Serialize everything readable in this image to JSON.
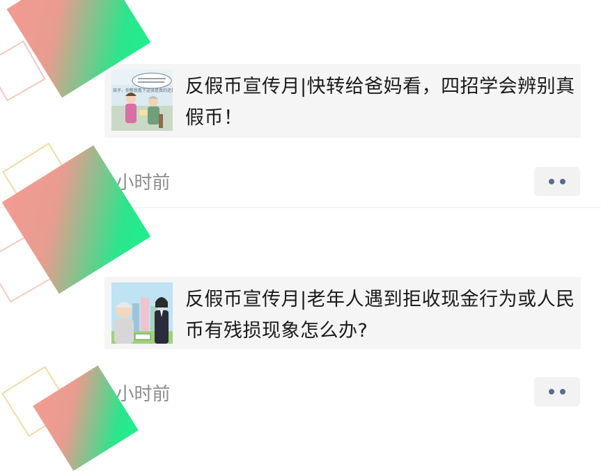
{
  "posts": [
    {
      "card_title": "反假币宣传月|快转给爸妈看，四招学会辨别真假币！",
      "thumbnail_bubble": "孩子，你帮我看下这张是真的还是假的？",
      "timestamp": "1小时前",
      "more_icon": "more-dots-icon"
    },
    {
      "card_title": "反假币宣传月|老年人遇到拒收现金行为或人民币有残损现象怎么办?",
      "timestamp": "1小时前",
      "more_icon": "more-dots-icon"
    }
  ],
  "colors": {
    "card_background": "#f5f5f5",
    "title_text": "#1a1a1a",
    "timestamp_text": "#8c8c8c",
    "more_dots": "#5b6b8c",
    "sticker_gradient_start": "#f39b93",
    "sticker_gradient_end": "#1ef08a"
  }
}
